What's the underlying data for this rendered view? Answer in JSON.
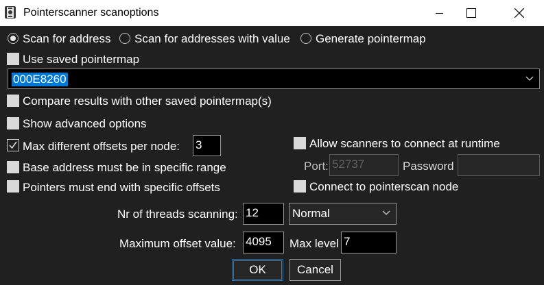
{
  "window": {
    "title": "Pointerscanner scanoptions",
    "minimize_icon": "minimize-icon",
    "maximize_icon": "maximize-icon",
    "close_icon": "close-icon"
  },
  "scan_mode": {
    "options": [
      "Scan for address",
      "Scan for addresses with value",
      "Generate pointermap"
    ],
    "selected": "Scan for address"
  },
  "use_saved_pointermap": {
    "label": "Use saved pointermap",
    "checked": false
  },
  "address_combo": {
    "value": "000E8260"
  },
  "compare_results": {
    "label": "Compare results with other saved pointermap(s)",
    "checked": false
  },
  "show_advanced": {
    "label": "Show advanced options",
    "checked": false
  },
  "max_offsets": {
    "label": "Max different offsets per node:",
    "checked": true,
    "value": "3"
  },
  "base_range": {
    "label": "Base address must be in specific range",
    "checked": false
  },
  "end_offsets": {
    "label": "Pointers must end with specific offsets",
    "checked": false
  },
  "allow_scanners": {
    "label": "Allow scanners to connect at runtime",
    "checked": false
  },
  "port": {
    "label": "Port:",
    "value": "52737"
  },
  "password": {
    "label": "Password",
    "value": ""
  },
  "connect_node": {
    "label": "Connect to pointerscan node",
    "checked": false
  },
  "threads": {
    "label": "Nr of threads scanning:",
    "value": "12",
    "priority": "Normal"
  },
  "max_offset_value": {
    "label": "Maximum offset value:",
    "value": "4095"
  },
  "max_level": {
    "label": "Max level",
    "value": "7"
  },
  "buttons": {
    "ok": "OK",
    "cancel": "Cancel"
  },
  "colors": {
    "background": "#202020",
    "selection": "#0078d7",
    "titlebar": "#ffffff"
  }
}
